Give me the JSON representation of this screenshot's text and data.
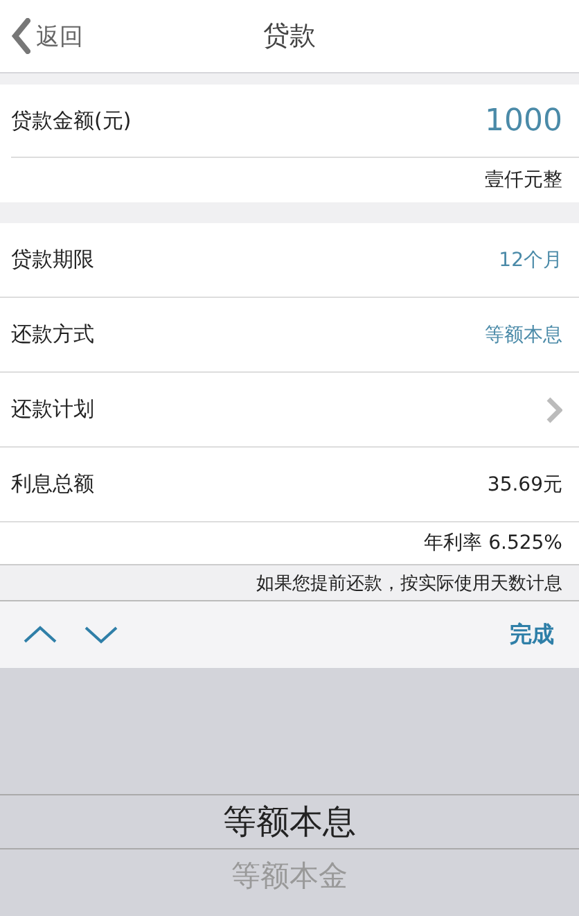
{
  "nav": {
    "back": "返回",
    "title": "贷款"
  },
  "amount": {
    "label": "贷款金额(元)",
    "value": "1000",
    "in_words": "壹仟元整"
  },
  "rows": [
    {
      "kind": "value",
      "label": "贷款期限",
      "value": "12个月",
      "accent": true
    },
    {
      "kind": "value",
      "label": "还款方式",
      "value": "等额本息",
      "accent": true
    },
    {
      "kind": "link",
      "label": "还款计划"
    },
    {
      "kind": "value",
      "label": "利息总额",
      "value": "35.69元",
      "accent": false
    }
  ],
  "rate": "年利率 6.525%",
  "note": "如果您提前还款，按实际使用天数计息",
  "toolbar": {
    "done": "完成"
  },
  "picker": [
    {
      "label": "等额本息",
      "selected": true
    },
    {
      "label": "等额本金",
      "selected": false
    }
  ]
}
